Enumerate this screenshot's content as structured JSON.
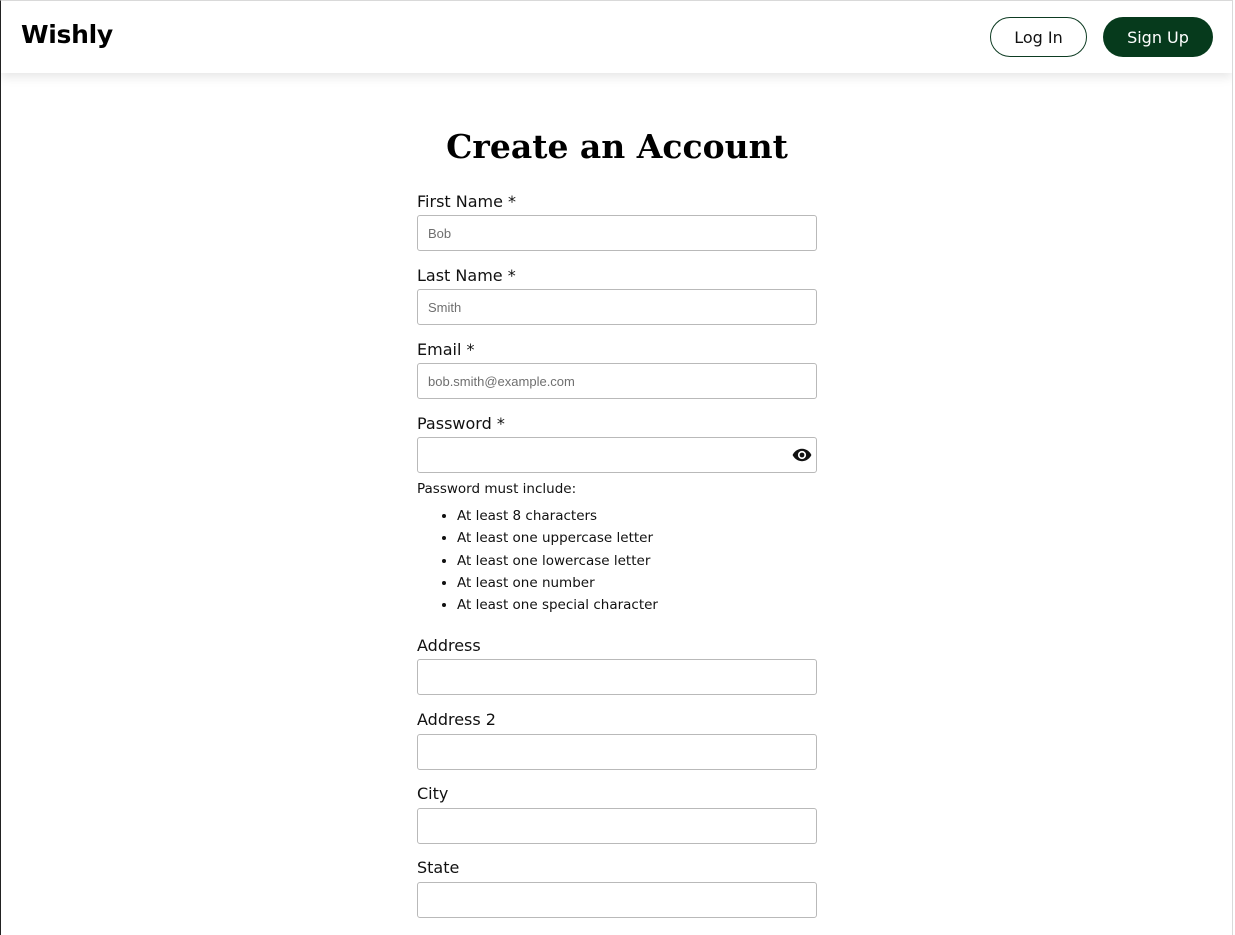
{
  "header": {
    "logo": "Wishly",
    "login_label": "Log In",
    "signup_label": "Sign Up"
  },
  "form": {
    "title": "Create an Account",
    "first_name": {
      "label": "First Name *",
      "placeholder": "Bob",
      "value": ""
    },
    "last_name": {
      "label": "Last Name *",
      "placeholder": "Smith",
      "value": ""
    },
    "email": {
      "label": "Email *",
      "placeholder": "bob.smith@example.com",
      "value": ""
    },
    "password": {
      "label": "Password *",
      "placeholder": "",
      "value": "",
      "toggle_icon": "eye-icon",
      "hint": "Password must include:",
      "rules": [
        "At least 8 characters",
        "At least one uppercase letter",
        "At least one lowercase letter",
        "At least one number",
        "At least one special character"
      ]
    },
    "address": {
      "label": "Address",
      "value": ""
    },
    "address2": {
      "label": "Address 2",
      "value": ""
    },
    "city": {
      "label": "City",
      "value": ""
    },
    "state": {
      "label": "State",
      "value": ""
    }
  },
  "colors": {
    "brand": "#063a1c",
    "text": "#111111",
    "input_border": "#b9b9b9"
  }
}
